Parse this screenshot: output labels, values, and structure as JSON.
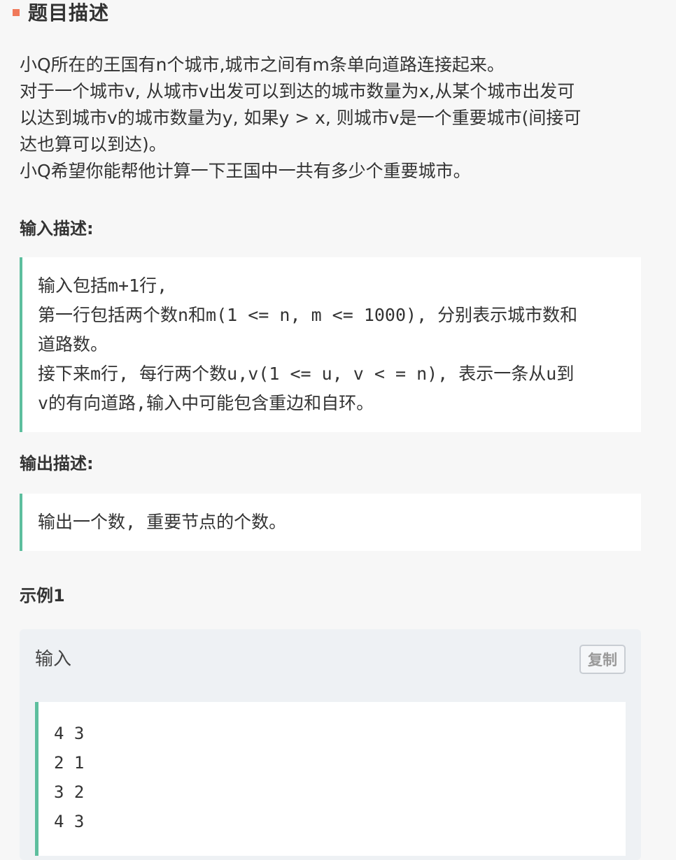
{
  "header": {
    "title": "题目描述",
    "marker_color": "#f0795a"
  },
  "description": {
    "lines": [
      "小Q所在的王国有n个城市,城市之间有m条单向道路连接起来。",
      "对于一个城市v, 从城市v出发可以到达的城市数量为x,从某个城市出发可",
      "以达到城市v的城市数量为y, 如果y > x, 则城市v是一个重要城市(间接可",
      "达也算可以到达)。",
      "小Q希望你能帮他计算一下王国中一共有多少个重要城市。"
    ]
  },
  "input_section": {
    "label": "输入描述:",
    "lines": [
      "输入包括m+1行,",
      "第一行包括两个数n和m(1 <= n, m <= 1000), 分别表示城市数和",
      "道路数。",
      "接下来m行, 每行两个数u,v(1 <= u, v < = n), 表示一条从u到",
      "v的有向道路,输入中可能包含重边和自环。"
    ]
  },
  "output_section": {
    "label": "输出描述:",
    "lines": [
      "输出一个数, 重要节点的个数。"
    ]
  },
  "example": {
    "label": "示例1",
    "input_label": "输入",
    "copy_label": "复制",
    "code_lines": [
      "4 3",
      "2 1",
      "3 2",
      "4 3"
    ]
  },
  "colors": {
    "accent_border": "#5dbe9e",
    "page_bg": "#f7f7f7",
    "example_bg": "#eef1f4"
  }
}
